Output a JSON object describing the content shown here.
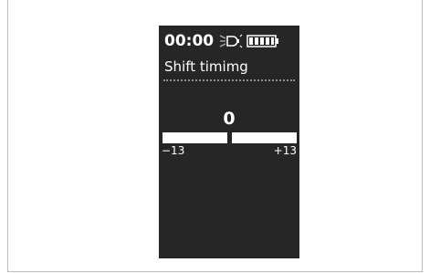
{
  "status": {
    "time": "00:00",
    "light_icon": "bike-light-icon",
    "battery_icon": "battery-full-icon"
  },
  "screen": {
    "title": "Shift timimg",
    "value": "0",
    "min_label": "−13",
    "max_label": "+13"
  },
  "colors": {
    "screen_background": "#262626",
    "text": "#ffffff",
    "divider": "#8a8a8a"
  }
}
